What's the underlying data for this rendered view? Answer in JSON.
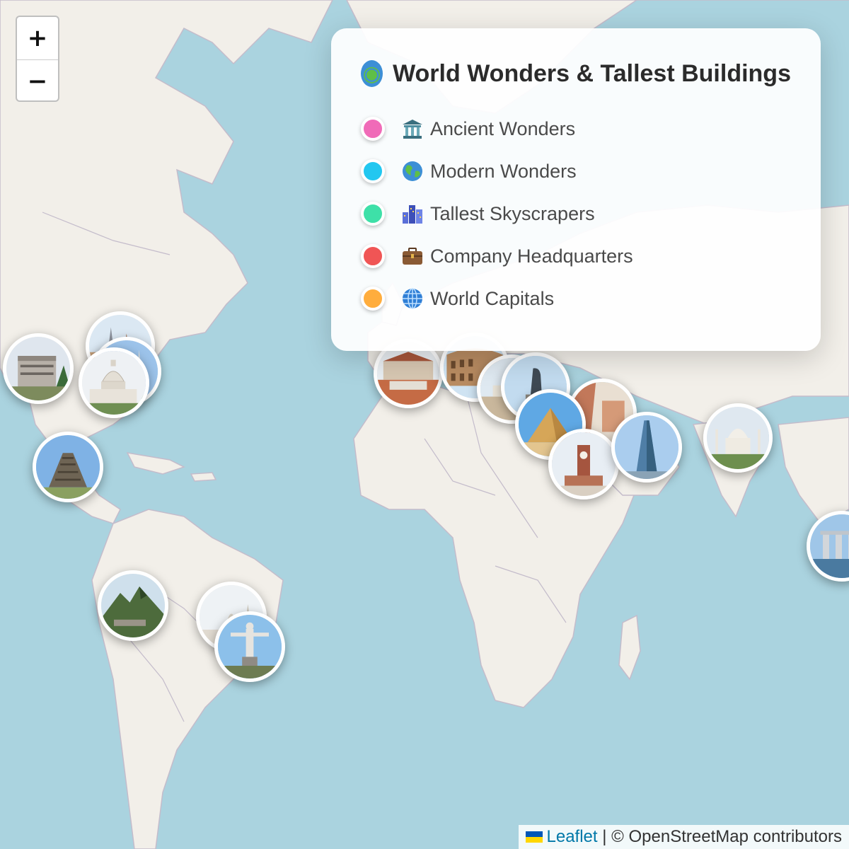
{
  "legend": {
    "title": "World Wonders & Tallest Buildings",
    "title_icon": "globe-icon",
    "items": [
      {
        "label": "Ancient Wonders",
        "color": "#f06bb8",
        "icon": "classical-building-icon"
      },
      {
        "label": "Modern Wonders",
        "color": "#22c7f0",
        "icon": "globe-icon"
      },
      {
        "label": "Tallest Skyscrapers",
        "color": "#3ee0a8",
        "icon": "cityscape-icon"
      },
      {
        "label": "Company Headquarters",
        "color": "#f05555",
        "icon": "briefcase-icon"
      },
      {
        "label": "World Capitals",
        "color": "#ffad3d",
        "icon": "globe-meridians-icon"
      }
    ]
  },
  "zoom": {
    "in_label": "+",
    "out_label": "−"
  },
  "attribution": {
    "leaflet": "Leaflet",
    "separator": " | ",
    "osm": "© OpenStreetMap contributors"
  },
  "colors": {
    "water": "#aad3df",
    "land": "#f2efe9",
    "border": "#c4bccb"
  },
  "markers": [
    {
      "name": "marker-office-building",
      "category": "Company Headquarters",
      "image": "office-building-photo"
    },
    {
      "name": "marker-toronto",
      "category": "World Capitals",
      "image": "spires-photo"
    },
    {
      "name": "marker-washington-monument",
      "category": "World Capitals",
      "image": "monument-photo"
    },
    {
      "name": "marker-us-capitol",
      "category": "World Capitals",
      "image": "capitol-dome-photo"
    },
    {
      "name": "marker-chichen-itza",
      "category": "Modern Wonders",
      "image": "pyramid-photo"
    },
    {
      "name": "marker-machu-picchu",
      "category": "Modern Wonders",
      "image": "mountain-ruins-photo"
    },
    {
      "name": "marker-brasilia",
      "category": "World Capitals",
      "image": "cathedral-photo"
    },
    {
      "name": "marker-christ-the-redeemer",
      "category": "Modern Wonders",
      "image": "statue-photo"
    },
    {
      "name": "marker-european-city",
      "category": "World Capitals",
      "image": "old-town-photo"
    },
    {
      "name": "marker-colosseum",
      "category": "Modern Wonders",
      "image": "colosseum-photo"
    },
    {
      "name": "marker-greek-site",
      "category": "Ancient Wonders",
      "image": "temple-photo"
    },
    {
      "name": "marker-statue-of-zeus",
      "category": "Ancient Wonders",
      "image": "statue-photo"
    },
    {
      "name": "marker-petra",
      "category": "Modern Wonders",
      "image": "rock-facade-photo"
    },
    {
      "name": "marker-great-pyramid",
      "category": "Ancient Wonders",
      "image": "pyramid-photo"
    },
    {
      "name": "marker-mecca-clock-tower",
      "category": "Tallest Skyscrapers",
      "image": "clock-tower-photo"
    },
    {
      "name": "marker-burj-khalifa",
      "category": "Tallest Skyscrapers",
      "image": "glass-tower-photo"
    },
    {
      "name": "marker-taj-mahal",
      "category": "Modern Wonders",
      "image": "taj-mahal-photo"
    },
    {
      "name": "marker-marina-bay-sands",
      "category": "Tallest Skyscrapers",
      "image": "skyline-photo"
    }
  ]
}
